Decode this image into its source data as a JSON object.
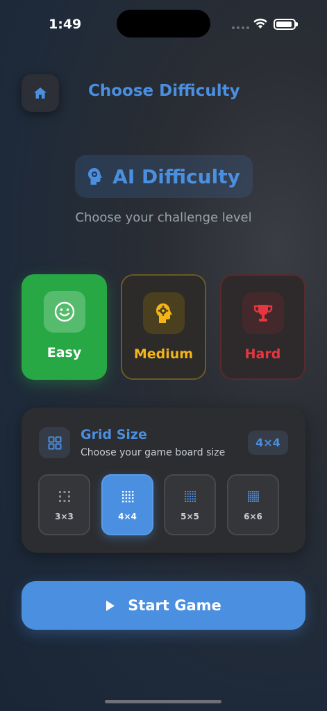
{
  "status_bar": {
    "time": "1:49"
  },
  "header": {
    "title": "Choose Difficulty",
    "home_icon": "home-icon"
  },
  "badge": {
    "title": "AI Difficulty",
    "icon": "brain-head-icon"
  },
  "subtitle": "Choose your challenge level",
  "difficulties": [
    {
      "label": "Easy",
      "icon": "smiley-icon",
      "color": "#27a844",
      "selected": true
    },
    {
      "label": "Medium",
      "icon": "gear-head-icon",
      "color": "#f2b418",
      "selected": false
    },
    {
      "label": "Hard",
      "icon": "trophy-icon",
      "color": "#e8363f",
      "selected": false
    }
  ],
  "grid_size": {
    "title": "Grid Size",
    "subtitle": "Choose your game board size",
    "current": "4×4",
    "options": [
      {
        "label": "3×3",
        "selected": false
      },
      {
        "label": "4×4",
        "selected": true
      },
      {
        "label": "5×5",
        "selected": false
      },
      {
        "label": "6×6",
        "selected": false
      }
    ]
  },
  "start_button": {
    "label": "Start Game",
    "icon": "play-icon"
  },
  "colors": {
    "accent": "#4a8fe0",
    "easy": "#27a844",
    "medium": "#f2b418",
    "hard": "#e8363f"
  }
}
